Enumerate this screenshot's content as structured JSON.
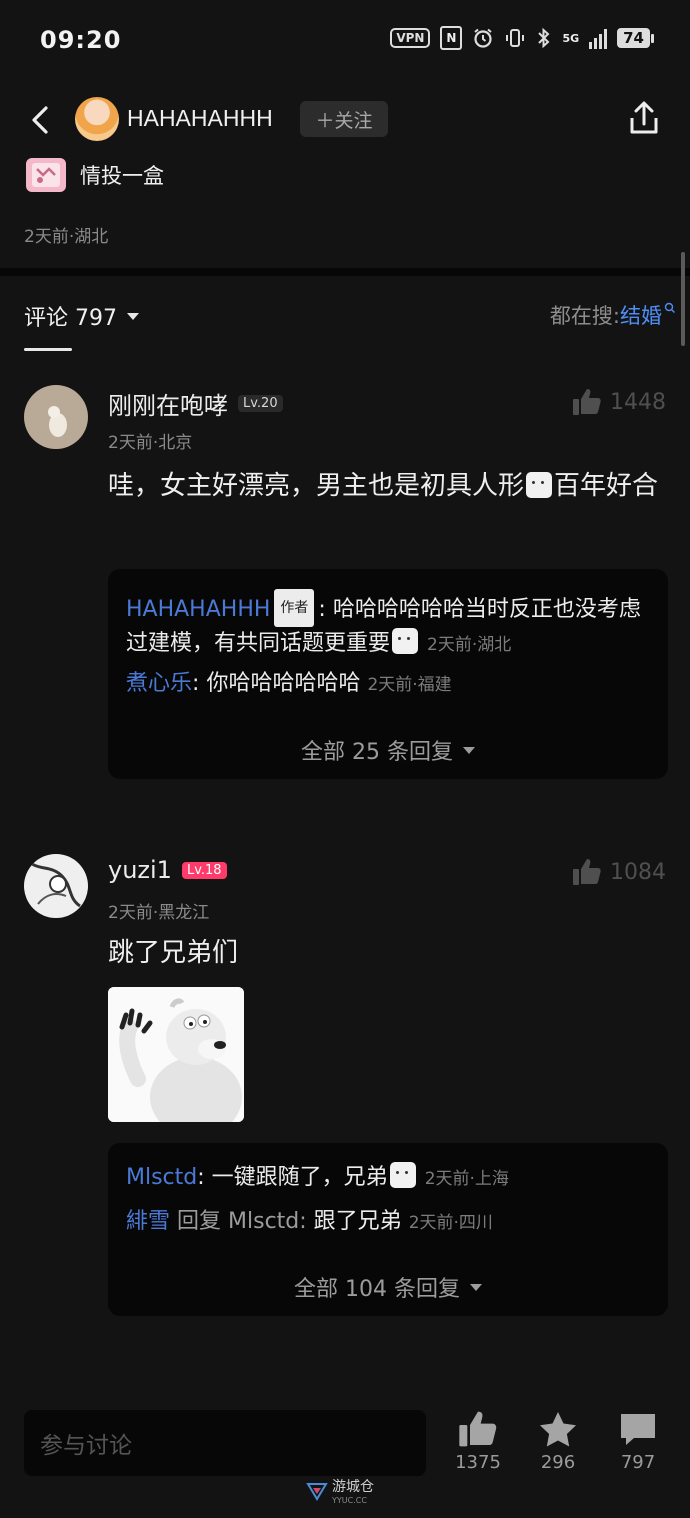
{
  "status_bar": {
    "time": "09:20",
    "vpn": "VPN",
    "nfc": "N",
    "network": "5G",
    "battery": "74"
  },
  "header": {
    "username": "HAHAHAHHH",
    "follow_label": "＋关注",
    "tag": "情投一盒",
    "meta": "2天前·湖北"
  },
  "comments_header": {
    "label": "评论 797",
    "search_prefix": "都在搜:",
    "search_keyword": "结婚"
  },
  "comments": [
    {
      "username": "刚刚在咆哮",
      "level": "Lv.20",
      "meta": "2天前·北京",
      "likes": "1448",
      "text_before": "哇，女主好漂亮，男主也是初具人形",
      "text_after": "百年好合",
      "replies": [
        {
          "name": "HAHAHAHHH",
          "tag": "作者",
          "sep": ":",
          "text": "哈哈哈哈哈哈当时反正也没考虑过建模，有共同话题更重要",
          "meta": "2天前·湖北"
        },
        {
          "name": "煮心乐",
          "sep": ":",
          "text": "你哈哈哈哈哈哈",
          "meta": "2天前·福建"
        }
      ],
      "all_replies": "全部 25 条回复"
    },
    {
      "username": "yuzi1",
      "level": "Lv.18",
      "meta": "2天前·黑龙江",
      "likes": "1084",
      "text": "跳了兄弟们",
      "replies": [
        {
          "name": "Mlsctd",
          "sep": ":",
          "text": "一键跟随了，兄弟",
          "meta": "2天前·上海"
        },
        {
          "name": "緋雪",
          "middle": "回复 Mlsctd:",
          "text": "跟了兄弟",
          "meta": "2天前·四川"
        }
      ],
      "all_replies": "全部 104 条回复"
    }
  ],
  "bottom_bar": {
    "input_placeholder": "参与讨论",
    "likes": "1375",
    "favorites": "296",
    "comments": "797"
  },
  "watermark": {
    "name": "游城仓",
    "url": "YYUC.CC"
  },
  "colors": {
    "background": "#131313",
    "link_blue": "#4a7ad6",
    "keyword_blue": "#4e8ef7",
    "level_badge_pink": "#ff3b6b"
  }
}
